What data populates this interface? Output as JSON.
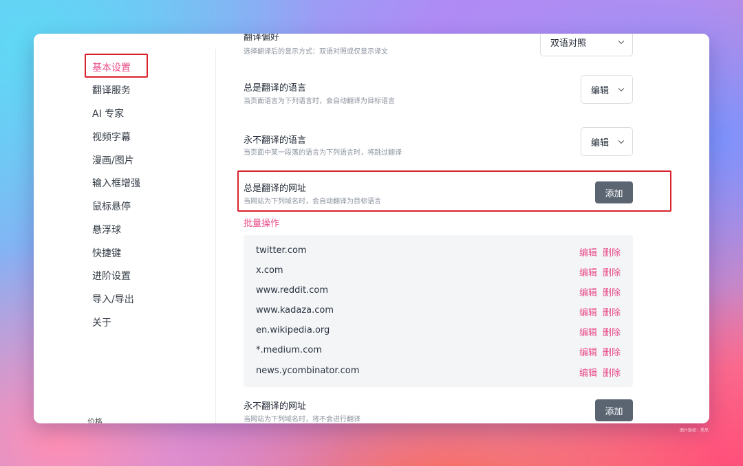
{
  "sidebar": {
    "items": [
      {
        "label": "基本设置",
        "active": true
      },
      {
        "label": "翻译服务"
      },
      {
        "label": "AI 专家"
      },
      {
        "label": "视频字幕"
      },
      {
        "label": "漫画/图片"
      },
      {
        "label": "输入框增强"
      },
      {
        "label": "鼠标悬停"
      },
      {
        "label": "悬浮球"
      },
      {
        "label": "快捷键"
      },
      {
        "label": "进阶设置"
      },
      {
        "label": "导入/导出"
      },
      {
        "label": "关于"
      }
    ],
    "footer_label": "价格"
  },
  "settings": {
    "translation_preference": {
      "title": "翻译偏好",
      "desc": "选择翻译后的显示方式：双语对照或仅显示译文",
      "value": "双语对照"
    },
    "always_translate_languages": {
      "title": "总是翻译的语言",
      "desc": "当页面语言为下列语言时，会自动翻译为目标语言",
      "button": "编辑"
    },
    "never_translate_languages": {
      "title": "永不翻译的语言",
      "desc": "当页面中某一段落的语言为下列语言时，将跳过翻译",
      "button": "编辑"
    },
    "always_translate_urls": {
      "title": "总是翻译的网址",
      "desc": "当网站为下列域名时，会自动翻译为目标语言",
      "add_label": "添加"
    },
    "batch_label": "批量操作",
    "url_list": [
      {
        "url": "twitter.com",
        "edit": "编辑",
        "delete": "删除"
      },
      {
        "url": "x.com",
        "edit": "编辑",
        "delete": "删除"
      },
      {
        "url": "www.reddit.com",
        "edit": "编辑",
        "delete": "删除"
      },
      {
        "url": "www.kadaza.com",
        "edit": "编辑",
        "delete": "删除"
      },
      {
        "url": "en.wikipedia.org",
        "edit": "编辑",
        "delete": "删除"
      },
      {
        "url": "*.medium.com",
        "edit": "编辑",
        "delete": "删除"
      },
      {
        "url": "news.ycombinator.com",
        "edit": "编辑",
        "delete": "删除"
      }
    ],
    "never_translate_urls": {
      "title": "永不翻译的网址",
      "desc": "当网站为下列域名时，将不会进行翻译",
      "add_label": "添加"
    }
  },
  "watermark": "图片版权：悉尼",
  "colors": {
    "accent": "#ea4c89",
    "highlight_box": "#d8222b",
    "button_bg": "#5b6572"
  }
}
